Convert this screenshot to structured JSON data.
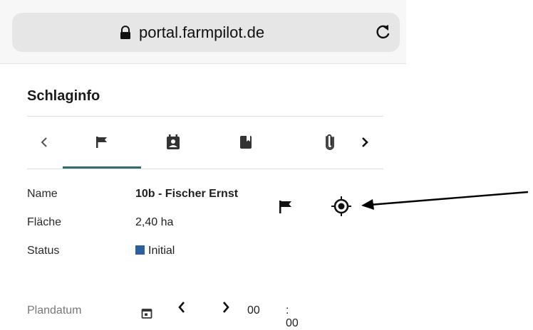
{
  "browser": {
    "url": "portal.farmpilot.de",
    "lock_icon": "lock-icon",
    "reload_icon": "reload-icon"
  },
  "page": {
    "title": "Schlaginfo"
  },
  "tabs": {
    "items": [
      {
        "icon": "chevron-left-icon"
      },
      {
        "icon": "flag-icon",
        "active": true
      },
      {
        "icon": "calendar-person-icon"
      },
      {
        "icon": "book-icon"
      },
      {
        "icon": "paperclip-icon"
      },
      {
        "icon": "chevron-right-icon"
      }
    ],
    "active_color": "#2f6d6a"
  },
  "info": {
    "name_label": "Name",
    "name_value": "10b - Fischer Ernst",
    "area_label": "Fläche",
    "area_value": "2,40 ha",
    "status_label": "Status",
    "status_value": "Initial",
    "status_color": "#2b5f9e"
  },
  "actions": {
    "flag_icon": "flag-icon",
    "locate_icon": "locate-icon"
  },
  "annotation": {
    "arrow": "arrow-left"
  },
  "plandatum": {
    "label": "Plandatum",
    "hour": "00",
    "minute": ": 00"
  }
}
